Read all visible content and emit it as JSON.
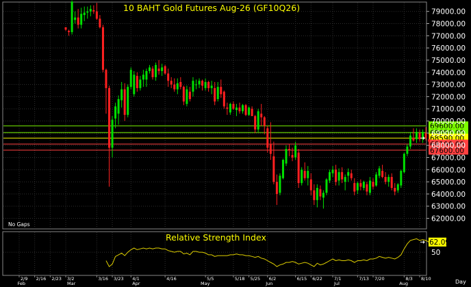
{
  "chart_data": {
    "type": "candlestick",
    "title": "10 BAHT  Gold  Futures  Aug-26  (GF10Q26)",
    "note": "No Gaps",
    "y_ticks": [
      62000,
      63000,
      64000,
      65000,
      66000,
      67000,
      68000,
      69000,
      70000,
      71000,
      72000,
      73000,
      74000,
      75000,
      76000,
      77000,
      78000,
      79000
    ],
    "y_tick_labels": [
      "62000.00",
      "63000.00",
      "64000.00",
      "65000.00",
      "66000.00",
      "67000.00",
      "68000.00",
      "69000.00",
      "70000.00",
      "71000.00",
      "72000.00",
      "73000.00",
      "74000.00",
      "75000.00",
      "76000.00",
      "77000.00",
      "78000.00",
      "79000.00"
    ],
    "ylim": [
      61300,
      79600
    ],
    "date_ticks": [
      {
        "label": "2/9",
        "index": 0
      },
      {
        "label": "2/16",
        "index": 5
      },
      {
        "label": "2/23",
        "index": 10
      },
      {
        "label": "3/2",
        "index": 15
      },
      {
        "label": "3/16",
        "index": 25
      },
      {
        "label": "3/23",
        "index": 30
      },
      {
        "label": "4/1",
        "index": 36
      },
      {
        "label": "4/16",
        "index": 47
      },
      {
        "label": "5/5",
        "index": 60
      },
      {
        "label": "5/18",
        "index": 69
      },
      {
        "label": "5/25",
        "index": 74
      },
      {
        "label": "6/2",
        "index": 80
      },
      {
        "label": "6/15",
        "index": 89
      },
      {
        "label": "6/22",
        "index": 94
      },
      {
        "label": "7/1",
        "index": 101
      },
      {
        "label": "7/13",
        "index": 109
      },
      {
        "label": "7/20",
        "index": 114
      },
      {
        "label": "8/3",
        "index": 124
      },
      {
        "label": "8/10",
        "index": 129
      }
    ],
    "month_labels": [
      {
        "label": "Feb",
        "index": -1
      },
      {
        "label": "Mar",
        "index": 15
      },
      {
        "label": "Apr",
        "index": 36
      },
      {
        "label": "May",
        "index": 58
      },
      {
        "label": "Jun",
        "index": 79
      },
      {
        "label": "Jul",
        "index": 101
      },
      {
        "label": "Aug",
        "index": 122
      }
    ],
    "period_label": "Day",
    "levels": [
      {
        "value": 69600,
        "label": "69600.00",
        "color": "#7cfc00",
        "text_color": "#000000"
      },
      {
        "value": 69050,
        "label": "69050.00",
        "color": "#7cfc00",
        "text_color": "#000000"
      },
      {
        "value": 68590,
        "label": "68590.00",
        "color": "#ffff00",
        "text_color": "#000000"
      },
      {
        "value": 68100,
        "label": "68100.00",
        "color": "#ff4040",
        "text_color": "#000000"
      },
      {
        "value": 67600,
        "label": "67600.00",
        "color": "#ff4040",
        "text_color": "#000000"
      }
    ],
    "candles": [
      [
        15,
        77700,
        77700,
        77400,
        77500
      ],
      [
        16,
        77400,
        77500,
        77000,
        77300
      ],
      [
        17,
        77300,
        79900,
        77100,
        79800
      ],
      [
        18,
        78300,
        79000,
        78000,
        78500
      ],
      [
        19,
        78500,
        79200,
        77600,
        77900
      ],
      [
        20,
        77900,
        79300,
        77600,
        78800
      ],
      [
        21,
        78700,
        79400,
        78200,
        78900
      ],
      [
        22,
        78900,
        79400,
        78400,
        79000
      ],
      [
        23,
        79000,
        79500,
        78600,
        79200
      ],
      [
        24,
        79100,
        79500,
        78800,
        79000
      ],
      [
        25,
        79000,
        79700,
        78300,
        78400
      ],
      [
        26,
        78400,
        78700,
        77600,
        77700
      ],
      [
        27,
        77700,
        77900,
        74000,
        74200
      ],
      [
        28,
        74200,
        74300,
        70600,
        72700
      ],
      [
        29,
        72700,
        72900,
        64600,
        67800
      ],
      [
        30,
        67800,
        70400,
        67000,
        70100
      ],
      [
        31,
        70200,
        71500,
        69400,
        71200
      ],
      [
        32,
        70600,
        72100,
        69700,
        71800
      ],
      [
        33,
        71700,
        73200,
        71100,
        72600
      ],
      [
        34,
        72600,
        73100,
        70000,
        70500
      ],
      [
        35,
        70500,
        73000,
        70300,
        72800
      ],
      [
        36,
        72800,
        74400,
        72600,
        74200
      ],
      [
        37,
        72200,
        74100,
        72000,
        73800
      ],
      [
        38,
        73700,
        74000,
        72400,
        72700
      ],
      [
        39,
        72700,
        73700,
        72500,
        73400
      ],
      [
        40,
        73400,
        74200,
        72800,
        73800
      ],
      [
        41,
        73400,
        74300,
        72800,
        74100
      ],
      [
        42,
        74100,
        74600,
        73900,
        74400
      ],
      [
        43,
        74300,
        74500,
        73400,
        73600
      ],
      [
        44,
        73600,
        74800,
        73300,
        74600
      ],
      [
        45,
        74300,
        75000,
        73800,
        74100
      ],
      [
        46,
        74100,
        74700,
        73700,
        74400
      ],
      [
        47,
        74500,
        74600,
        73800,
        73900
      ],
      [
        48,
        73900,
        74300,
        72800,
        73300
      ],
      [
        49,
        73300,
        73600,
        72700,
        73000
      ],
      [
        50,
        73000,
        73500,
        72400,
        72600
      ],
      [
        51,
        72600,
        73500,
        72200,
        73100
      ],
      [
        52,
        73200,
        73600,
        72600,
        72800
      ],
      [
        53,
        72800,
        72900,
        71300,
        71600
      ],
      [
        54,
        71400,
        72900,
        71200,
        72600
      ],
      [
        55,
        72400,
        72800,
        71600,
        71800
      ],
      [
        56,
        72400,
        73600,
        72000,
        73300
      ],
      [
        57,
        73000,
        73400,
        72600,
        73000
      ],
      [
        58,
        73000,
        73500,
        72700,
        73300
      ],
      [
        59,
        73300,
        73400,
        72500,
        72900
      ],
      [
        60,
        72700,
        73500,
        72500,
        73200
      ],
      [
        61,
        73200,
        73300,
        72400,
        72700
      ],
      [
        62,
        72700,
        73300,
        72200,
        72900
      ],
      [
        63,
        72700,
        73200,
        71300,
        71600
      ],
      [
        64,
        71800,
        73200,
        71600,
        72800
      ],
      [
        65,
        72800,
        73400,
        71900,
        72200
      ],
      [
        66,
        72400,
        72500,
        71000,
        71200
      ],
      [
        67,
        71100,
        71500,
        70500,
        71000
      ],
      [
        68,
        70700,
        71500,
        70500,
        71400
      ],
      [
        69,
        71400,
        71600,
        70900,
        71000
      ],
      [
        70,
        70900,
        71400,
        70400,
        71100
      ],
      [
        71,
        71100,
        71500,
        70600,
        70800
      ],
      [
        72,
        70800,
        71400,
        70600,
        71300
      ],
      [
        73,
        71300,
        71400,
        70400,
        70500
      ],
      [
        74,
        70500,
        71200,
        70400,
        71100
      ],
      [
        75,
        71000,
        71200,
        70400,
        70400
      ],
      [
        76,
        70400,
        70500,
        69000,
        69300
      ],
      [
        77,
        69300,
        71000,
        69100,
        70800
      ],
      [
        78,
        70600,
        71400,
        69600,
        70300
      ],
      [
        79,
        70300,
        70400,
        68900,
        69600
      ],
      [
        80,
        69400,
        69600,
        67400,
        67800
      ],
      [
        81,
        68100,
        69900,
        66800,
        67300
      ],
      [
        82,
        67100,
        68300,
        64800,
        65000
      ],
      [
        83,
        65000,
        65600,
        63100,
        64000
      ],
      [
        84,
        64100,
        65700,
        63900,
        65500
      ],
      [
        85,
        65300,
        66900,
        65200,
        66800
      ],
      [
        86,
        66500,
        68000,
        66300,
        67700
      ],
      [
        87,
        67700,
        68100,
        67100,
        67600
      ],
      [
        88,
        67200,
        67800,
        66700,
        67000
      ],
      [
        89,
        67000,
        68300,
        66800,
        68000
      ],
      [
        90,
        67400,
        67700,
        64500,
        64900
      ],
      [
        91,
        64900,
        66200,
        64700,
        66000
      ],
      [
        92,
        65900,
        66600,
        65100,
        65300
      ],
      [
        93,
        65300,
        66300,
        64700,
        65900
      ],
      [
        94,
        65200,
        65700,
        63900,
        64300
      ],
      [
        95,
        64300,
        64800,
        63100,
        63500
      ],
      [
        96,
        63500,
        64800,
        62900,
        64500
      ],
      [
        97,
        64400,
        64700,
        63500,
        63800
      ],
      [
        98,
        63700,
        64300,
        62800,
        64100
      ],
      [
        99,
        64100,
        65300,
        63900,
        65200
      ],
      [
        100,
        65100,
        66000,
        64900,
        65800
      ],
      [
        101,
        65700,
        66300,
        65400,
        66000
      ],
      [
        102,
        66000,
        66400,
        64700,
        65000
      ],
      [
        103,
        65100,
        66100,
        64700,
        65800
      ],
      [
        104,
        65800,
        66200,
        64900,
        65200
      ],
      [
        105,
        65000,
        65600,
        64300,
        65400
      ],
      [
        106,
        65500,
        66100,
        65000,
        65800
      ],
      [
        107,
        65700,
        66000,
        65100,
        65300
      ],
      [
        108,
        64900,
        65300,
        63900,
        64200
      ],
      [
        109,
        64300,
        65000,
        64000,
        64900
      ],
      [
        110,
        64900,
        65200,
        64300,
        64600
      ],
      [
        111,
        64500,
        65100,
        64300,
        65000
      ],
      [
        112,
        64800,
        65000,
        63900,
        64200
      ],
      [
        113,
        64100,
        65400,
        63900,
        65100
      ],
      [
        114,
        65000,
        65300,
        64400,
        64600
      ],
      [
        115,
        64700,
        65800,
        64600,
        65600
      ],
      [
        116,
        65500,
        66300,
        65300,
        66100
      ],
      [
        117,
        65900,
        66400,
        65300,
        65400
      ],
      [
        118,
        65400,
        65800,
        64800,
        65000
      ],
      [
        119,
        65000,
        65600,
        64600,
        65400
      ],
      [
        120,
        65400,
        65700,
        64300,
        64500
      ],
      [
        121,
        64500,
        64900,
        63900,
        64200
      ],
      [
        122,
        64300,
        64900,
        64100,
        64800
      ],
      [
        123,
        64700,
        66000,
        64500,
        65900
      ],
      [
        124,
        65800,
        67400,
        65700,
        67300
      ],
      [
        125,
        67300,
        68100,
        67100,
        67900
      ],
      [
        126,
        67900,
        69100,
        67700,
        68800
      ],
      [
        127,
        68600,
        69400,
        68300,
        68400
      ],
      [
        128,
        68500,
        69400,
        68200,
        69100
      ],
      [
        129,
        69000,
        69300,
        68300,
        68500
      ],
      [
        130,
        68500,
        69300,
        68200,
        69100
      ],
      [
        131,
        69000,
        69500,
        68400,
        68600
      ],
      [
        132,
        68500,
        68900,
        68000,
        68300
      ]
    ],
    "current_price": 68590,
    "rsi": {
      "title": "Relative Strength Index",
      "value": 62.09,
      "value_label": "62.09",
      "mid_label": "50",
      "mid": 50,
      "ylim": [
        25,
        72
      ],
      "values": [
        [
          28,
          40
        ],
        [
          29,
          33
        ],
        [
          30,
          36
        ],
        [
          31,
          45
        ],
        [
          32,
          47
        ],
        [
          33,
          49
        ],
        [
          34,
          46
        ],
        [
          35,
          50
        ],
        [
          36,
          53
        ],
        [
          37,
          55
        ],
        [
          38,
          53
        ],
        [
          39,
          54
        ],
        [
          40,
          55
        ],
        [
          41,
          54
        ],
        [
          42,
          55
        ],
        [
          43,
          54
        ],
        [
          44,
          55
        ],
        [
          45,
          55
        ],
        [
          46,
          54
        ],
        [
          47,
          54
        ],
        [
          48,
          52
        ],
        [
          49,
          51
        ],
        [
          50,
          50
        ],
        [
          51,
          51
        ],
        [
          52,
          51
        ],
        [
          53,
          48
        ],
        [
          54,
          49
        ],
        [
          55,
          47
        ],
        [
          56,
          51
        ],
        [
          57,
          51
        ],
        [
          58,
          50
        ],
        [
          59,
          50
        ],
        [
          60,
          49
        ],
        [
          61,
          47
        ],
        [
          62,
          47
        ],
        [
          63,
          45
        ],
        [
          64,
          46
        ],
        [
          65,
          46
        ],
        [
          66,
          46
        ],
        [
          67,
          46
        ],
        [
          68,
          47
        ],
        [
          69,
          47
        ],
        [
          70,
          48
        ],
        [
          71,
          47
        ],
        [
          72,
          47
        ],
        [
          73,
          46
        ],
        [
          74,
          46
        ],
        [
          75,
          45
        ],
        [
          76,
          44
        ],
        [
          77,
          45
        ],
        [
          78,
          43
        ],
        [
          79,
          42
        ],
        [
          80,
          40
        ],
        [
          81,
          38
        ],
        [
          82,
          36
        ],
        [
          83,
          33
        ],
        [
          84,
          35
        ],
        [
          85,
          36
        ],
        [
          86,
          38
        ],
        [
          87,
          38
        ],
        [
          88,
          39
        ],
        [
          89,
          38
        ],
        [
          90,
          36
        ],
        [
          91,
          37
        ],
        [
          92,
          38
        ],
        [
          93,
          37
        ],
        [
          94,
          35
        ],
        [
          95,
          33
        ],
        [
          96,
          37
        ],
        [
          97,
          35
        ],
        [
          98,
          36
        ],
        [
          99,
          38
        ],
        [
          100,
          40
        ],
        [
          101,
          42
        ],
        [
          102,
          40
        ],
        [
          103,
          41
        ],
        [
          104,
          40
        ],
        [
          105,
          40
        ],
        [
          106,
          41
        ],
        [
          107,
          40
        ],
        [
          108,
          38
        ],
        [
          109,
          40
        ],
        [
          110,
          40
        ],
        [
          111,
          41
        ],
        [
          112,
          40
        ],
        [
          113,
          42
        ],
        [
          114,
          42
        ],
        [
          115,
          43
        ],
        [
          116,
          45
        ],
        [
          117,
          44
        ],
        [
          118,
          43
        ],
        [
          119,
          44
        ],
        [
          120,
          43
        ],
        [
          121,
          42
        ],
        [
          122,
          44
        ],
        [
          123,
          47
        ],
        [
          124,
          54
        ],
        [
          125,
          60
        ],
        [
          126,
          64
        ],
        [
          127,
          65
        ],
        [
          128,
          66
        ],
        [
          129,
          64
        ],
        [
          130,
          65
        ],
        [
          131,
          64
        ],
        [
          132,
          62
        ]
      ]
    },
    "colors": {
      "up": "#00e000",
      "down": "#ff2020",
      "rsi_line": "#e0d000",
      "grid": "#303030",
      "text": "#ffffff",
      "title": "#ffff00"
    }
  }
}
